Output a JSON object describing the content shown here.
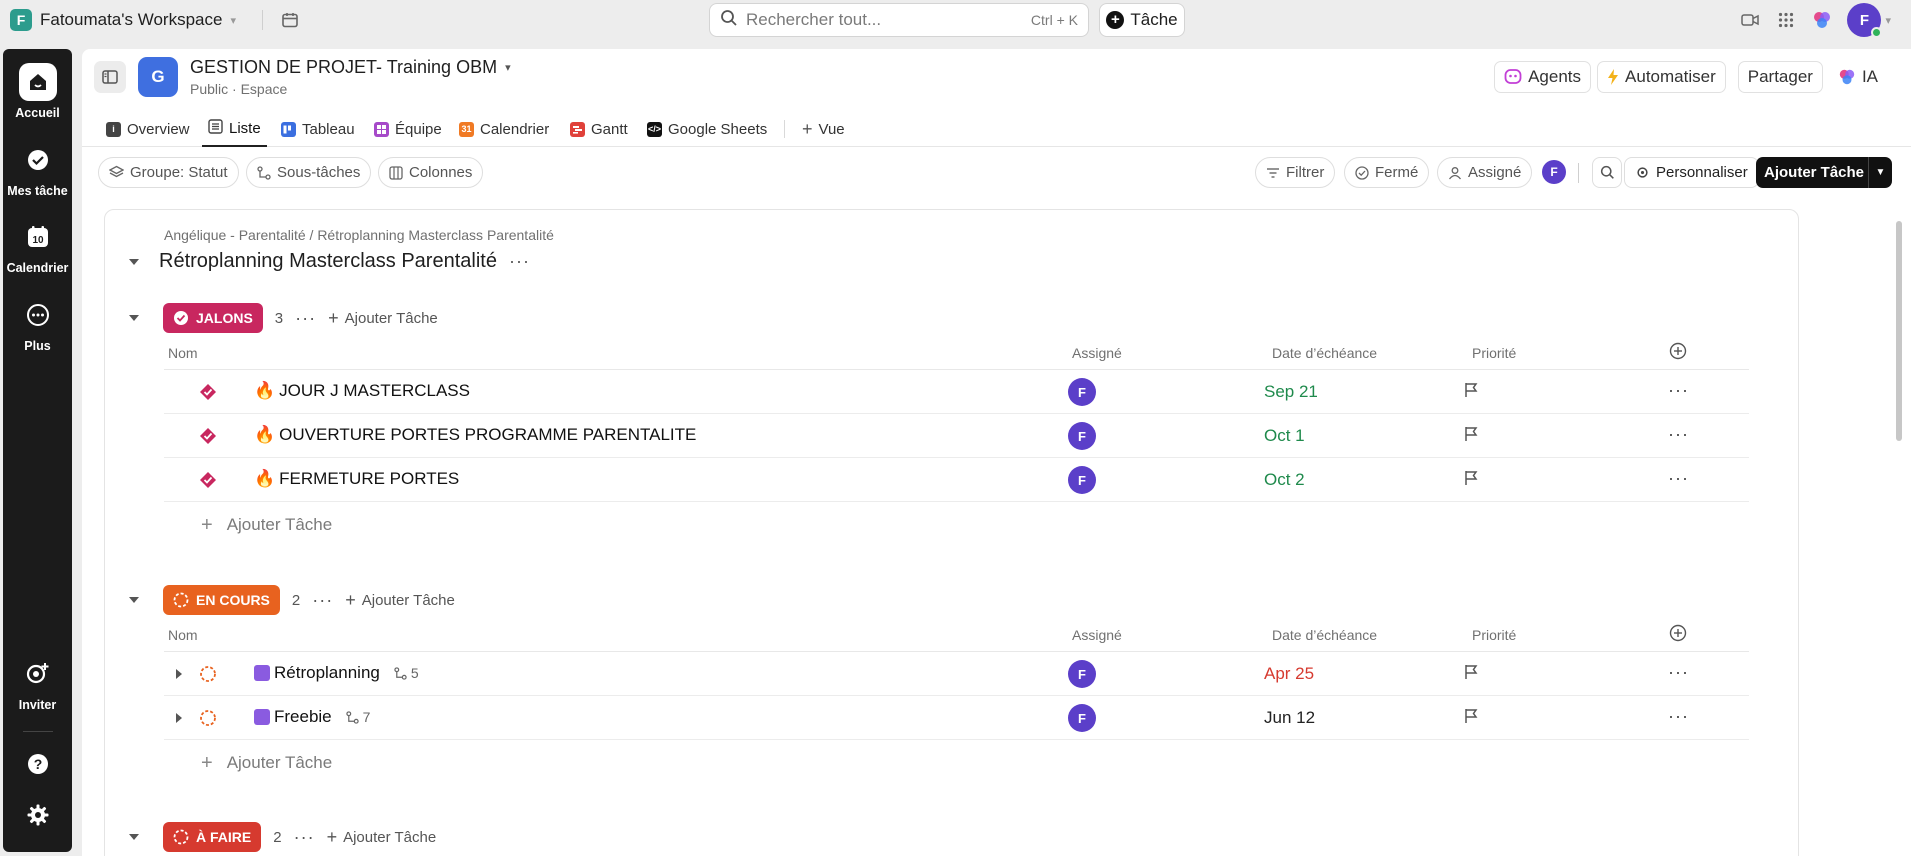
{
  "workspace": {
    "initial": "F",
    "name": "Fatoumata's Workspace"
  },
  "search": {
    "placeholder": "Rechercher tout...",
    "shortcut": "Ctrl + K"
  },
  "top_actions": {
    "new_task_label": "Tâche",
    "user_initial": "F"
  },
  "rail": {
    "items": [
      {
        "label": "Accueil",
        "icon": "home-icon"
      },
      {
        "label": "Mes tâche",
        "icon": "check-circle-icon"
      },
      {
        "label": "Calendrier",
        "icon": "calendar-icon",
        "badge": "10"
      },
      {
        "label": "Plus",
        "icon": "more-icon"
      }
    ],
    "invite_label": "Inviter"
  },
  "space": {
    "initial": "G",
    "title": "GESTION DE PROJET- Training OBM",
    "subtitle": "Public · Espace",
    "actions": {
      "agents": "Agents",
      "automate": "Automatiser",
      "share": "Partager",
      "ai": "IA"
    }
  },
  "tabs": [
    {
      "label": "Overview",
      "color": "#444444"
    },
    {
      "label": "Liste",
      "color": "#444444",
      "active": true
    },
    {
      "label": "Tableau",
      "color": "#3b6fe0"
    },
    {
      "label": "Équipe",
      "color": "#a64ac9"
    },
    {
      "label": "Calendrier",
      "color": "#f07a24",
      "icon_text": "31"
    },
    {
      "label": "Gantt",
      "color": "#e0413a"
    },
    {
      "label": "Google Sheets",
      "color": "#111111"
    },
    {
      "label": "Vue",
      "color": "#444444"
    }
  ],
  "toolbar": {
    "group_by": "Groupe: Statut",
    "subtasks": "Sous-tâches",
    "columns": "Colonnes",
    "filter": "Filtrer",
    "closed": "Fermé",
    "assignee": "Assigné",
    "user_initial": "F",
    "customize": "Personnaliser",
    "add_task": "Ajouter Tâche"
  },
  "list": {
    "breadcrumb": "Angélique - Parentalité / Rétroplanning Masterclass Parentalité",
    "title": "Rétroplanning Masterclass Parentalité"
  },
  "columns": {
    "name": "Nom",
    "assignee": "Assigné",
    "due": "Date d’échéance",
    "priority": "Priorité"
  },
  "add_task_label": "Ajouter Tâche",
  "groups": [
    {
      "status": "JALONS",
      "color": "#c8275f",
      "count": "3",
      "tasks": [
        {
          "name": "JOUR J MASTERCLASS",
          "assignee": "F",
          "due": "Sep 21",
          "due_color": "#1f8a4c"
        },
        {
          "name": "OUVERTURE PORTES PROGRAMME PARENTALITE",
          "assignee": "F",
          "due": "Oct 1",
          "due_color": "#1f8a4c"
        },
        {
          "name": "FERMETURE PORTES",
          "assignee": "F",
          "due": "Oct 2",
          "due_color": "#1f8a4c"
        }
      ]
    },
    {
      "status": "EN COURS",
      "color": "#e8621f",
      "count": "2",
      "tasks": [
        {
          "name": "Rétroplanning",
          "subtasks": "5",
          "assignee": "F",
          "due": "Apr 25",
          "due_color": "#d63a2f"
        },
        {
          "name": "Freebie",
          "subtasks": "7",
          "assignee": "F",
          "due": "Jun 12",
          "due_color": "#222222"
        }
      ]
    },
    {
      "status": "À FAIRE",
      "color": "#d63a2f",
      "count": "2"
    }
  ]
}
